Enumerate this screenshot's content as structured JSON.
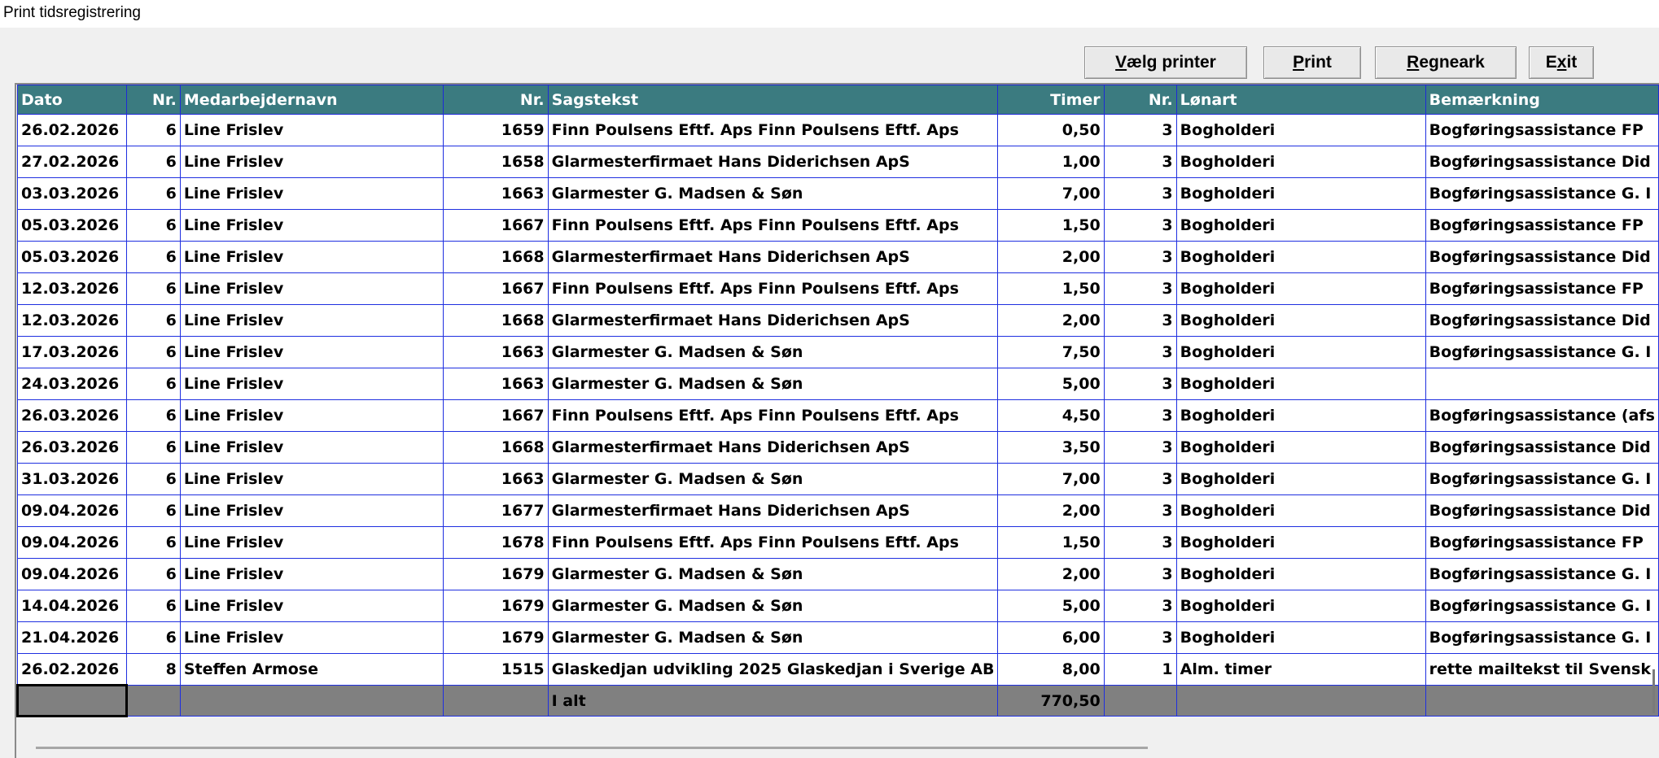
{
  "window": {
    "title": "Print tidsregistrering"
  },
  "toolbar": {
    "choose_printer": {
      "accel": "V",
      "rest": "ælg printer"
    },
    "print": {
      "accel": "P",
      "rest": "rint"
    },
    "spreadsheet": {
      "accel": "R",
      "rest": "egneark"
    },
    "exit": {
      "pre": "E",
      "accel": "x",
      "rest": "it"
    }
  },
  "table": {
    "columns": [
      "Dato",
      "Nr.",
      "Medarbejdernavn",
      "Nr.",
      "Sagstekst",
      "Timer",
      "Nr.",
      "Lønart",
      "Bemærkning"
    ],
    "rows": [
      [
        "26.02.2026",
        "6",
        "Line Frislev",
        "1659",
        "Finn Poulsens Eftf. Aps Finn Poulsens Eftf. Aps",
        "0,50",
        "3",
        "Bogholderi",
        "Bogføringsassistance FP"
      ],
      [
        "27.02.2026",
        "6",
        "Line Frislev",
        "1658",
        "Glarmesterfirmaet Hans Diderichsen ApS",
        "1,00",
        "3",
        "Bogholderi",
        "Bogføringsassistance Did"
      ],
      [
        "03.03.2026",
        "6",
        "Line Frislev",
        "1663",
        "Glarmester G. Madsen & Søn",
        "7,00",
        "3",
        "Bogholderi",
        "Bogføringsassistance G. I"
      ],
      [
        "05.03.2026",
        "6",
        "Line Frislev",
        "1667",
        "Finn Poulsens Eftf. Aps Finn Poulsens Eftf. Aps",
        "1,50",
        "3",
        "Bogholderi",
        "Bogføringsassistance FP"
      ],
      [
        "05.03.2026",
        "6",
        "Line Frislev",
        "1668",
        "Glarmesterfirmaet Hans Diderichsen ApS",
        "2,00",
        "3",
        "Bogholderi",
        "Bogføringsassistance Did"
      ],
      [
        "12.03.2026",
        "6",
        "Line Frislev",
        "1667",
        "Finn Poulsens Eftf. Aps Finn Poulsens Eftf. Aps",
        "1,50",
        "3",
        "Bogholderi",
        "Bogføringsassistance FP"
      ],
      [
        "12.03.2026",
        "6",
        "Line Frislev",
        "1668",
        "Glarmesterfirmaet Hans Diderichsen ApS",
        "2,00",
        "3",
        "Bogholderi",
        "Bogføringsassistance Did"
      ],
      [
        "17.03.2026",
        "6",
        "Line Frislev",
        "1663",
        "Glarmester G. Madsen & Søn",
        "7,50",
        "3",
        "Bogholderi",
        "Bogføringsassistance G. I"
      ],
      [
        "24.03.2026",
        "6",
        "Line Frislev",
        "1663",
        "Glarmester G. Madsen & Søn",
        "5,00",
        "3",
        "Bogholderi",
        ""
      ],
      [
        "26.03.2026",
        "6",
        "Line Frislev",
        "1667",
        "Finn Poulsens Eftf. Aps Finn Poulsens Eftf. Aps",
        "4,50",
        "3",
        "Bogholderi",
        "Bogføringsassistance (afs"
      ],
      [
        "26.03.2026",
        "6",
        "Line Frislev",
        "1668",
        "Glarmesterfirmaet Hans Diderichsen ApS",
        "3,50",
        "3",
        "Bogholderi",
        "Bogføringsassistance Did"
      ],
      [
        "31.03.2026",
        "6",
        "Line Frislev",
        "1663",
        "Glarmester G. Madsen & Søn",
        "7,00",
        "3",
        "Bogholderi",
        "Bogføringsassistance G. I"
      ],
      [
        "09.04.2026",
        "6",
        "Line Frislev",
        "1677",
        "Glarmesterfirmaet Hans Diderichsen ApS",
        "2,00",
        "3",
        "Bogholderi",
        "Bogføringsassistance Did"
      ],
      [
        "09.04.2026",
        "6",
        "Line Frislev",
        "1678",
        "Finn Poulsens Eftf. Aps Finn Poulsens Eftf. Aps",
        "1,50",
        "3",
        "Bogholderi",
        "Bogføringsassistance FP"
      ],
      [
        "09.04.2026",
        "6",
        "Line Frislev",
        "1679",
        "Glarmester G. Madsen & Søn",
        "2,00",
        "3",
        "Bogholderi",
        "Bogføringsassistance G. I"
      ],
      [
        "14.04.2026",
        "6",
        "Line Frislev",
        "1679",
        "Glarmester G. Madsen & Søn",
        "5,00",
        "3",
        "Bogholderi",
        "Bogføringsassistance G. I"
      ],
      [
        "21.04.2026",
        "6",
        "Line Frislev",
        "1679",
        "Glarmester G. Madsen & Søn",
        "6,00",
        "3",
        "Bogholderi",
        "Bogføringsassistance G. I"
      ],
      [
        "26.02.2026",
        "8",
        "Steffen Armose",
        "1515",
        "Glaskedjan udvikling 2025 Glaskedjan i Sverige AB",
        "8,00",
        "1",
        "Alm. timer",
        "rette mailtekst til Svensk"
      ]
    ],
    "total": {
      "label": "I alt",
      "timer": "770,50"
    }
  }
}
